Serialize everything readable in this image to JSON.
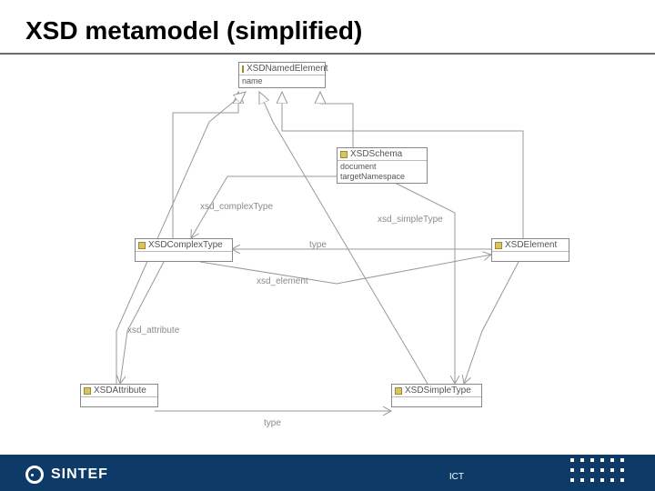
{
  "title": "XSD metamodel (simplified)",
  "footer": {
    "brand": "SINTEF",
    "right_label": "ICT"
  },
  "classes": {
    "named": {
      "name": "XSDNamedElement",
      "attrs": [
        "name"
      ]
    },
    "schema": {
      "name": "XSDSchema",
      "attrs": [
        "document",
        "targetNamespace"
      ]
    },
    "complex": {
      "name": "XSDComplexType",
      "attrs": [
        ""
      ]
    },
    "element": {
      "name": "XSDElement",
      "attrs": [
        ""
      ]
    },
    "attribute": {
      "name": "XSDAttribute",
      "attrs": [
        ""
      ]
    },
    "simple": {
      "name": "XSDSimpleType",
      "attrs": [
        ""
      ]
    }
  },
  "assoc_labels": {
    "xsd_complexType": "xsd_complexType",
    "xsd_simpleType": "xsd_simpleType",
    "type_top": "type",
    "xsd_element": "xsd_element",
    "xsd_attribute": "xsd_attribute",
    "type_bottom": "type"
  }
}
